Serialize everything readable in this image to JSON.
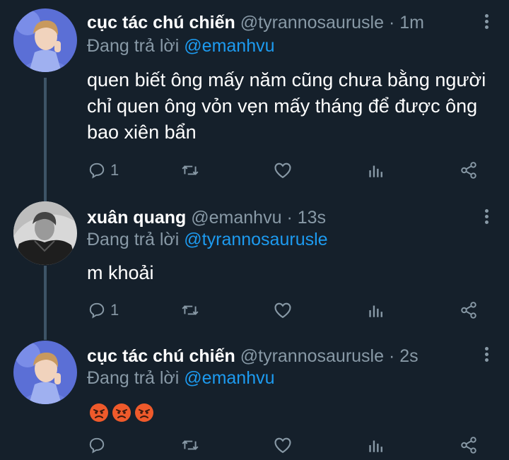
{
  "tweets": [
    {
      "name": "cục tác chú chiến",
      "handle": "@tyrannosaurusle",
      "separator": "·",
      "time": "1m",
      "reply_prefix": "Đang trả lời",
      "reply_to": "@emanhvu",
      "text_lines": [
        "quen biết ông mấy năm cũng chưa bằng người",
        "chỉ quen ông vỏn vẹn mấy tháng để được ông",
        "bao xiên bẩn"
      ],
      "reply_count": "1"
    },
    {
      "name": "xuân quang",
      "handle": "@emanhvu",
      "separator": "·",
      "time": "13s",
      "reply_prefix": "Đang trả lời",
      "reply_to": "@tyrannosaurusle",
      "text_lines": [
        "m khoải"
      ],
      "reply_count": "1"
    },
    {
      "name": "cục tác chú chiến",
      "handle": "@tyrannosaurusle",
      "separator": "·",
      "time": "2s",
      "reply_prefix": "Đang trả lời",
      "reply_to": "@emanhvu",
      "emojis": [
        "angry-face",
        "angry-face",
        "angry-face"
      ],
      "reply_count": ""
    }
  ],
  "colors": {
    "background": "#15202b",
    "secondary_text": "#8899a6",
    "mention": "#1d9bf0",
    "thread_line": "#3d5466"
  }
}
